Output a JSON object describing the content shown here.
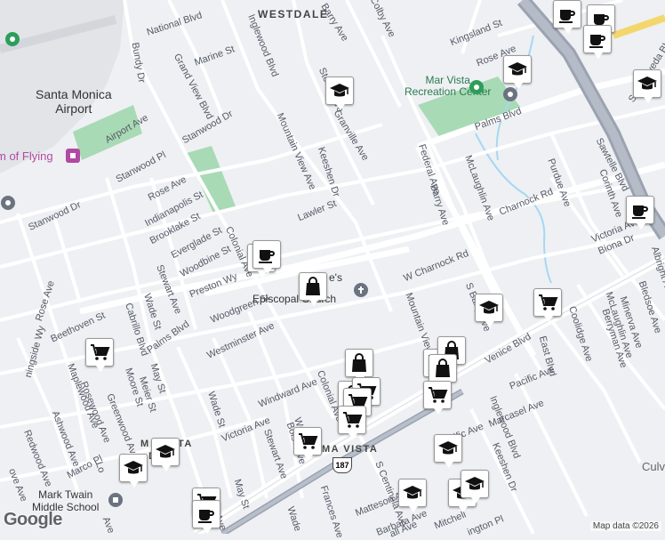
{
  "districts": [
    "WESTDALE"
  ],
  "pois": {
    "airport": "Santa Monica\nAirport",
    "flying": "m of Flying",
    "rec_center": "Mar Vista\nRecreation Center",
    "school": "Mark Twain\nMiddle School",
    "church": "Episcopal Church",
    "church_tail": "e's",
    "mar_vista_gardens": "M  VISTA\n  DENS",
    "mar_vista_label": "MA  VISTA",
    "culver": "Culv"
  },
  "streets": [
    {
      "t": "National Blvd"
    },
    {
      "t": "Barry Ave"
    },
    {
      "t": "Colby Ave"
    },
    {
      "t": "Kingsland St"
    },
    {
      "t": "Rose Ave"
    },
    {
      "t": "Grand View Blvd"
    },
    {
      "t": "Marine St"
    },
    {
      "t": "Inglewood Blvd"
    },
    {
      "t": "Bundy Dr"
    },
    {
      "t": "Stoner Ave"
    },
    {
      "t": "Granville Ave"
    },
    {
      "t": "Palms Blvd"
    },
    {
      "t": "Airport Ave"
    },
    {
      "t": "Stanwood Dr"
    },
    {
      "t": "Mountain View Ave"
    },
    {
      "t": "Keeshen Dr"
    },
    {
      "t": "Federal Ave"
    },
    {
      "t": "McLaughlin Ave"
    },
    {
      "t": "Sawtelle Blvd"
    },
    {
      "t": "S Sepulveda Blvd"
    },
    {
      "t": "Stanwood Pl"
    },
    {
      "t": "Rose Ave"
    },
    {
      "t": "Indianapolis St"
    },
    {
      "t": "Brooklake St"
    },
    {
      "t": "Everglade St"
    },
    {
      "t": "Woodbine St"
    },
    {
      "t": "Colonial Ave"
    },
    {
      "t": "Lawler St"
    },
    {
      "t": "Barry Ave"
    },
    {
      "t": "Purdue Ave"
    },
    {
      "t": "Corinth Ave"
    },
    {
      "t": "Charnock Rd"
    },
    {
      "t": "Victoria Ave"
    },
    {
      "t": "Biona Dr"
    },
    {
      "t": "W Charnock Rd"
    },
    {
      "t": "Stanwood Dr"
    },
    {
      "t": "Preston Wy"
    },
    {
      "t": "Stewart Ave"
    },
    {
      "t": "Wade St"
    },
    {
      "t": "Palms Blvd"
    },
    {
      "t": "Rose Ave"
    },
    {
      "t": "Cabrillo Blvd"
    },
    {
      "t": "Woodgreen St"
    },
    {
      "t": "Westminster Ave"
    },
    {
      "t": "Beethoven St"
    },
    {
      "t": "Mountain View Ave"
    },
    {
      "t": "S Barry Ave"
    },
    {
      "t": "Venice Blvd"
    },
    {
      "t": "East Blvd"
    },
    {
      "t": "McLaughlin Ave"
    },
    {
      "t": "Coolidge Ave"
    },
    {
      "t": "Berryman Ave"
    },
    {
      "t": "Minerva Ave"
    },
    {
      "t": "Bledsoe Ave"
    },
    {
      "t": "Albright Ave"
    },
    {
      "t": "ningside Wy"
    },
    {
      "t": "May St"
    },
    {
      "t": "Meier St"
    },
    {
      "t": "Moore St"
    },
    {
      "t": "Windward Ave"
    },
    {
      "t": "Wade St"
    },
    {
      "t": "Colonial Ave"
    },
    {
      "t": "Pacific Ave"
    },
    {
      "t": "Marcasel Ave"
    },
    {
      "t": "Maplewood Ave"
    },
    {
      "t": "Rosewood Ave"
    },
    {
      "t": "Greenwood Ave"
    },
    {
      "t": "Ashwood Ave"
    },
    {
      "t": "Victoria Ave"
    },
    {
      "t": "Stewart Ave"
    },
    {
      "t": "Inglewood Blvd"
    },
    {
      "t": "Redwood Ave"
    },
    {
      "t": "Marco Pl"
    },
    {
      "t": "Wa"
    },
    {
      "t": "Boise Ave"
    },
    {
      "t": "May St"
    },
    {
      "t": "Pacific Ave"
    },
    {
      "t": "Keeshen Dr"
    },
    {
      "t": "S Centinela Ave"
    },
    {
      "t": "Matteson Ave"
    },
    {
      "t": "Barbara Ave"
    },
    {
      "t": "Frances Ave"
    },
    {
      "t": "Mitchell"
    },
    {
      "t": "ington Pl"
    },
    {
      "t": "Wade"
    },
    {
      "t": "ove Ave"
    },
    {
      "t": "Lo"
    },
    {
      "t": "all Ave"
    },
    {
      "t": "Ave"
    },
    {
      "t": "Ave"
    }
  ],
  "route_shield": "187",
  "pins": [
    {
      "icon": "coffee-icon"
    },
    {
      "icon": "coffee-icon"
    },
    {
      "icon": "coffee-icon"
    },
    {
      "icon": "graduation-cap-icon"
    },
    {
      "icon": "graduation-cap-icon"
    },
    {
      "icon": "coffee-icon"
    },
    {
      "icon": "graduation-cap-icon"
    },
    {
      "icon": "coffee-icon"
    },
    {
      "icon": "coffee-icon"
    },
    {
      "icon": "shopping-bag-icon"
    },
    {
      "icon": "graduation-cap-icon"
    },
    {
      "icon": "shopping-cart-icon"
    },
    {
      "icon": "shopping-cart-icon"
    },
    {
      "icon": "shopping-bag-icon"
    },
    {
      "icon": "shopping-cart-icon"
    },
    {
      "icon": "shopping-bag-icon"
    },
    {
      "icon": "shopping-bag-icon"
    },
    {
      "icon": "shopping-cart-icon"
    },
    {
      "icon": "shopping-bag-icon"
    },
    {
      "icon": "shopping-cart-icon"
    },
    {
      "icon": "shopping-cart-icon"
    },
    {
      "icon": "shopping-cart-icon"
    },
    {
      "icon": "shopping-cart-icon"
    },
    {
      "icon": "graduation-cap-icon"
    },
    {
      "icon": "graduation-cap-icon"
    },
    {
      "icon": "graduation-cap-icon"
    },
    {
      "icon": "graduation-cap-icon"
    },
    {
      "icon": "graduation-cap-icon"
    },
    {
      "icon": "graduation-cap-icon"
    },
    {
      "icon": "shopping-cart-icon"
    },
    {
      "icon": "coffee-icon"
    }
  ],
  "footer": {
    "google": "Google",
    "mapdata": "Map data ©2026"
  },
  "colors": {
    "bg": "#eef0f3",
    "road": "#ffffff",
    "highway": "#9ba3b1",
    "park": "#a8dab5",
    "pin_icon": "#111111",
    "poi_green": "#2e9d5a",
    "poi_purple": "#b24aa3",
    "poi_gray": "#6b7280"
  }
}
